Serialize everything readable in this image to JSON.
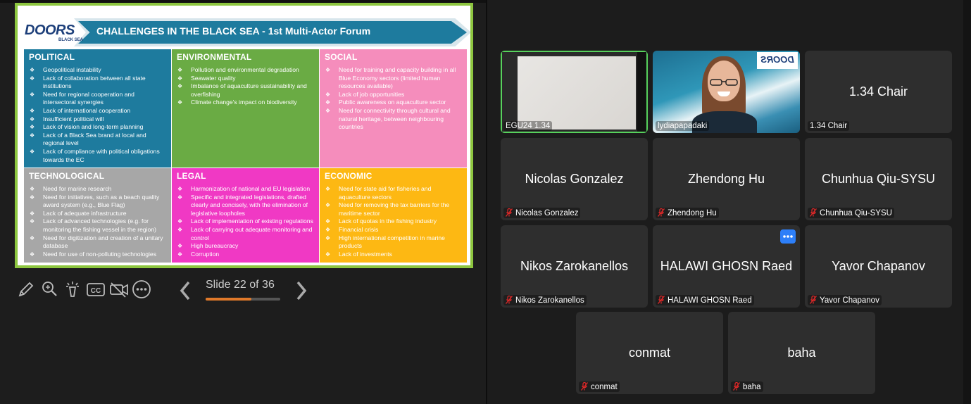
{
  "slide": {
    "logo_text": "DOORS",
    "logo_sub": "BLACK SEA",
    "title": "CHALLENGES IN THE BLACK SEA - 1st Multi-Actor Forum",
    "cells": [
      {
        "heading": "POLITICAL",
        "items": [
          "Geopolitical instability",
          "Lack of collaboration between all state institutions",
          "Need for regional cooperation and intersectoral synergies",
          "Lack of international cooperation",
          "Insufficient political will",
          "Lack of vision and long-term planning",
          "Lack of a Black Sea brand at local and regional level",
          "Lack of compliance with political obligations towards the EC"
        ]
      },
      {
        "heading": "ENVIRONMENTAL",
        "items": [
          "Pollution and environmental degradation",
          "Seawater quality",
          "Imbalance of aquaculture sustainability and overfishing",
          "Climate change's impact on biodiversity"
        ]
      },
      {
        "heading": "SOCIAL",
        "items": [
          "Need for training and capacity building in all Blue Economy sectors (limited human resources available)",
          "Lack of job opportunities",
          "Public awareness on aquaculture sector",
          "Need for connectivity through cultural and natural heritage, between neighbouring countries"
        ]
      },
      {
        "heading": "TECHNOLOGICAL",
        "items": [
          "Need for marine research",
          "Need for initiatives, such as a beach quality award system (e.g., Blue Flag)",
          "Lack of adequate infrastructure",
          "Lack of advanced technologies (e.g. for monitoring the fishing vessel in the region)",
          "Need for digitization and creation of a unitary database",
          "Need for use of non-polluting technologies"
        ]
      },
      {
        "heading": "LEGAL",
        "items": [
          "Harmonization of national and EU legislation",
          "Specific and integrated legislations, drafted clearly and concisely, with the elimination of legislative loopholes",
          "Lack of implementation of existing regulations",
          "Lack of carrying out adequate monitoring and control",
          "High bureaucracy",
          "Corruption"
        ]
      },
      {
        "heading": "ECONOMIC",
        "items": [
          "Need for state aid for fisheries and aquaculture sectors",
          "Need for removing the tax barriers for the maritime sector",
          "Lack of quotas in the fishing industry",
          "Financial crisis",
          "High international competition in marine products",
          "Lack of investments"
        ]
      }
    ]
  },
  "toolbar": {
    "counter": "Slide 22 of 36",
    "progress": 0.61,
    "accent": "#e0792a",
    "icons": [
      "pen-icon",
      "zoom-icon",
      "laser-pointer-icon",
      "closed-captions-icon",
      "video-icon",
      "more-icon",
      "chevron-left-icon",
      "chevron-right-icon"
    ]
  },
  "participants": {
    "egu": {
      "label": "EGU24 1.34"
    },
    "lydia": {
      "label": "lydiapapadaki"
    },
    "chair": {
      "center": "1.34 Chair",
      "label": "1.34 Chair"
    },
    "nicolas": {
      "center": "Nicolas Gonzalez",
      "label": "Nicolas Gonzalez"
    },
    "zhendong": {
      "center": "Zhendong Hu",
      "label": "Zhendong Hu"
    },
    "chunhua": {
      "center": "Chunhua Qiu-SYSU",
      "label": "Chunhua Qiu-SYSU"
    },
    "nikos": {
      "center": "Nikos Zarokanellos",
      "label": "Nikos Zarokanellos"
    },
    "halawi": {
      "center": "HALAWI GHOSN Raed",
      "label": "HALAWI GHOSN Raed"
    },
    "yavor": {
      "center": "Yavor Chapanov",
      "label": "Yavor Chapanov"
    },
    "conmat": {
      "center": "conmat",
      "label": "conmat"
    },
    "baha": {
      "center": "baha",
      "label": "baha"
    }
  },
  "colors": {
    "active_speaker": "#57d15c",
    "muted_icon": "#e02828",
    "more_button": "#2d7ff9"
  }
}
